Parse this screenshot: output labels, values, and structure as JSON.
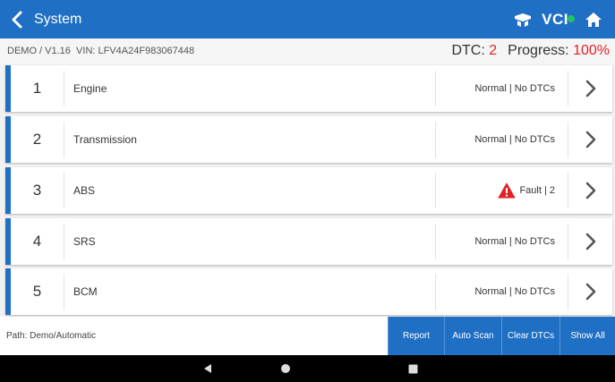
{
  "header": {
    "title": "System",
    "vci_label": "VCI",
    "icons": [
      "back-chevron-icon",
      "scan-glasses-icon",
      "vci-status-icon",
      "home-icon"
    ],
    "accent": "#1f6fc4",
    "vci_status_color": "#22c55e"
  },
  "info": {
    "version": "DEMO / V1.16",
    "vin": "VIN: LFV4A24F983067448",
    "dtc_label": "DTC:",
    "dtc_value": "2",
    "progress_label": "Progress:",
    "progress_value": "100%",
    "alert_color": "#e02424"
  },
  "systems": [
    {
      "num": "1",
      "name": "Engine",
      "status": "Normal | No DTCs",
      "fault": false
    },
    {
      "num": "2",
      "name": "Transmission",
      "status": "Normal | No DTCs",
      "fault": false
    },
    {
      "num": "3",
      "name": "ABS",
      "status": "Fault | 2",
      "fault": true
    },
    {
      "num": "4",
      "name": "SRS",
      "status": "Normal | No DTCs",
      "fault": false
    },
    {
      "num": "5",
      "name": "BCM",
      "status": "Normal | No DTCs",
      "fault": false
    }
  ],
  "footer": {
    "path": "Path: Demo/Automatic",
    "buttons": [
      "Report",
      "Auto Scan",
      "Clear DTCs",
      "Show All"
    ]
  }
}
